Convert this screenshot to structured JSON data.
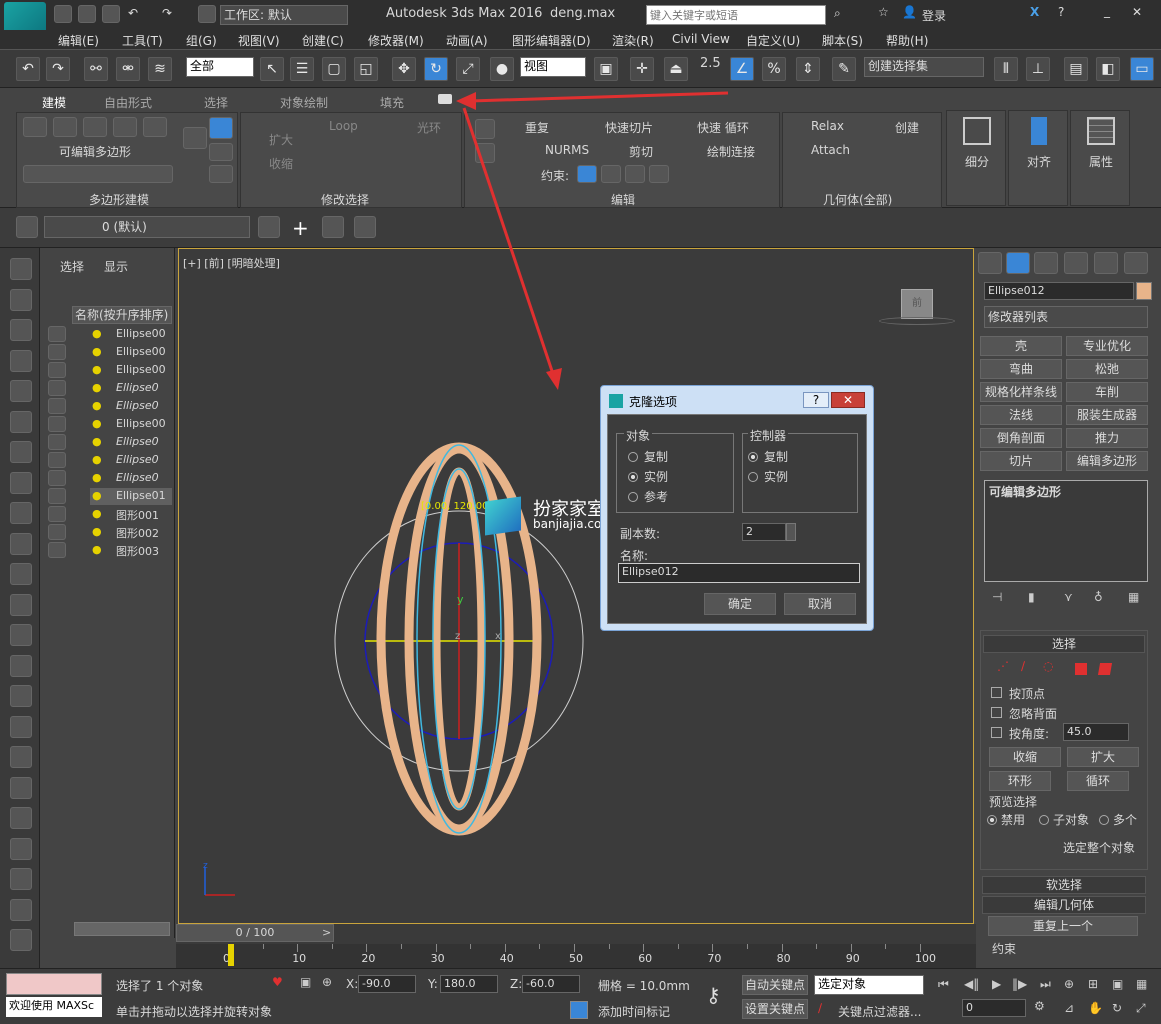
{
  "titlebar": {
    "workspace_label": "工作区: 默认",
    "app_title": "Autodesk 3ds Max 2016",
    "file_name": "deng.max",
    "search_placeholder": "键入关键字或短语",
    "login": "登录",
    "app_logo": "MAX"
  },
  "menu": [
    "编辑(E)",
    "工具(T)",
    "组(G)",
    "视图(V)",
    "创建(C)",
    "修改器(M)",
    "动画(A)",
    "图形编辑器(D)",
    "渲染(R)",
    "Civil View",
    "自定义(U)",
    "脚本(S)",
    "帮助(H)"
  ],
  "toolbar": {
    "filter_select": "全部",
    "view_select": "视图",
    "snap_value": "2.5",
    "selection_set": "创建选择集"
  },
  "ribbon": {
    "tabs": [
      "建模",
      "自由形式",
      "选择",
      "对象绘制",
      "填充"
    ],
    "editable_poly": "可编辑多边形",
    "poly_modeling": "多边形建模",
    "grow": "扩大",
    "shrink": "收缩",
    "loop": "Loop",
    "ring": "光环",
    "modify_selection": "修改选择",
    "repeat": "重复",
    "quick_slice": "快速切片",
    "quick_loop": "快速 循环",
    "nurms": "NURMS",
    "cut": "剪切",
    "paint_connect": "绘制连接",
    "constraint": "约束:",
    "edit": "编辑",
    "relax": "Relax",
    "create": "创建",
    "attach": "Attach",
    "geometry_all": "几何体(全部)",
    "subdivide": "细分",
    "align": "对齐",
    "properties": "属性"
  },
  "layerbar": {
    "layer_name": "0 (默认)"
  },
  "scene_explorer": {
    "tab_select": "选择",
    "tab_display": "显示",
    "header": "名称(按升序排序)",
    "items": [
      "Ellipse00",
      "Ellipse00",
      "Ellipse00",
      "Ellipse0",
      "Ellipse0",
      "Ellipse00",
      "Ellipse0",
      "Ellipse0",
      "Ellipse0",
      "Ellipse01",
      "图形001",
      "图形002",
      "图形003"
    ]
  },
  "viewport": {
    "label": "[+] [前] [明暗处理]",
    "coord_tag": "[0.00, 120.00",
    "axis_y": "y",
    "axis_z": "z",
    "axis_x": "x",
    "viewcube": "前"
  },
  "watermark": {
    "name": "扮家家室内设计",
    "url": "banjiajia.com"
  },
  "dialog": {
    "title": "克隆选项",
    "help": "?",
    "group_object": "对象",
    "copy": "复制",
    "instance": "实例",
    "reference": "参考",
    "group_controller": "控制器",
    "ctrl_copy": "复制",
    "ctrl_instance": "实例",
    "count_label": "副本数:",
    "count_value": "2",
    "name_label": "名称:",
    "name_value": "Ellipse012",
    "ok": "确定",
    "cancel": "取消"
  },
  "cmdpanel": {
    "object_name": "Ellipse012",
    "modifier_list": "修改器列表",
    "buttons": [
      "壳",
      "专业优化",
      "弯曲",
      "松弛",
      "规格化样条线",
      "车削",
      "法线",
      "服装生成器",
      "倒角剖面",
      "推力",
      "切片",
      "编辑多边形"
    ],
    "stack_item": "可编辑多边形",
    "selection_title": "选择",
    "by_vertex": "按顶点",
    "ignore_backface": "忽略背面",
    "by_angle": "按角度:",
    "angle_value": "45.0",
    "shrink": "收缩",
    "grow": "扩大",
    "ring": "环形",
    "loop": "循环",
    "preview_select": "预览选择",
    "disabled": "禁用",
    "subobject": "子对象",
    "multi": "多个",
    "select_whole": "选定整个对象",
    "soft_select": "软选择",
    "edit_geometry": "编辑几何体",
    "repeat_last": "重复上一个",
    "constraint": "约束"
  },
  "timeline": {
    "frame_counter": "0 / 100",
    "ticks": [
      "0",
      "10",
      "20",
      "30",
      "40",
      "50",
      "60",
      "70",
      "80",
      "90",
      "100"
    ]
  },
  "status": {
    "welcome": "欢迎使用 MAXSc",
    "selected": "选择了 1 个对象",
    "hint": "单击并拖动以选择并旋转对象",
    "x_label": "X:",
    "x_value": "-90.0",
    "y_label": "Y:",
    "y_value": "180.0",
    "z_label": "Z:",
    "z_value": "-60.0",
    "grid": "栅格 = 10.0mm",
    "add_time_tag": "添加时间标记",
    "auto_key": "自动关键点",
    "set_key": "设置关键点",
    "key_mode": "选定对象",
    "key_filters": "关键点过滤器...",
    "frame_value": "0"
  },
  "colors": {
    "accent_blue": "#3a86d6",
    "arrow_red": "#e03030",
    "ring_color": "#e8b48a",
    "viewport_border": "#c9a43c"
  }
}
